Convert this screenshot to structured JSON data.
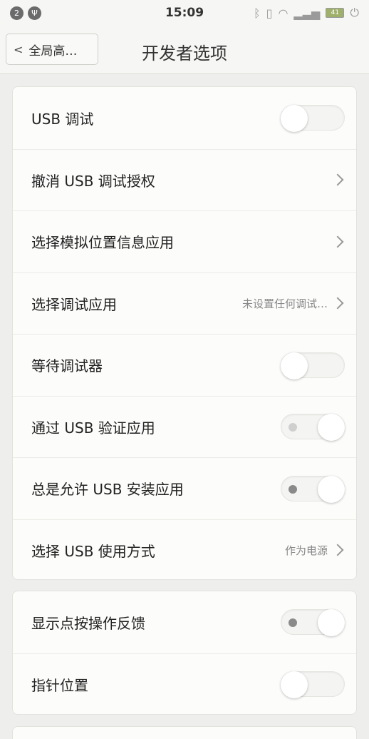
{
  "status_bar": {
    "time": "15:09",
    "left_badge": "2",
    "battery": "41"
  },
  "title_bar": {
    "back_label": "全局高…",
    "title": "开发者选项"
  },
  "card1": [
    {
      "label": "USB 调试",
      "type": "toggle",
      "state": "off"
    },
    {
      "label": "撤消 USB 调试授权",
      "type": "link"
    },
    {
      "label": "选择模拟位置信息应用",
      "type": "link"
    },
    {
      "label": "选择调试应用",
      "type": "link",
      "value": "未设置任何调试…"
    },
    {
      "label": "等待调试器",
      "type": "toggle",
      "state": "off"
    },
    {
      "label": "通过 USB 验证应用",
      "type": "toggle",
      "state": "on-disabled"
    },
    {
      "label": "总是允许 USB 安装应用",
      "type": "toggle",
      "state": "on"
    },
    {
      "label": "选择 USB 使用方式",
      "type": "link",
      "value": "作为电源"
    }
  ],
  "card2": [
    {
      "label": "显示点按操作反馈",
      "type": "toggle",
      "state": "on"
    },
    {
      "label": "指针位置",
      "type": "toggle",
      "state": "off"
    }
  ],
  "colors": {
    "background": "#eeeeec",
    "card": "#fcfcfb",
    "text": "#222222",
    "secondary_text": "#888888"
  }
}
